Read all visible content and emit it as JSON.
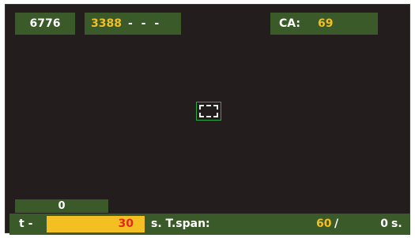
{
  "header": {
    "counter": "6776",
    "half_value": "3388",
    "half_dashes": "- - -",
    "ca_label": "CA:",
    "ca_value": "69"
  },
  "status": {
    "zero_value": "0"
  },
  "footer": {
    "t_label": "t -",
    "t_value": "30",
    "t_unit_and_span_label": "s. T.span:",
    "span_value": "60",
    "span_separator": "/",
    "end_value": "0",
    "end_unit": "s."
  },
  "colors": {
    "background": "#231e1d",
    "panel_green": "#3a5a2a",
    "accent_yellow": "#f3bf22",
    "alert_red": "#e5281e",
    "target_green": "#2aa84a"
  },
  "icons": {
    "center_target": "target-reticle-icon"
  }
}
